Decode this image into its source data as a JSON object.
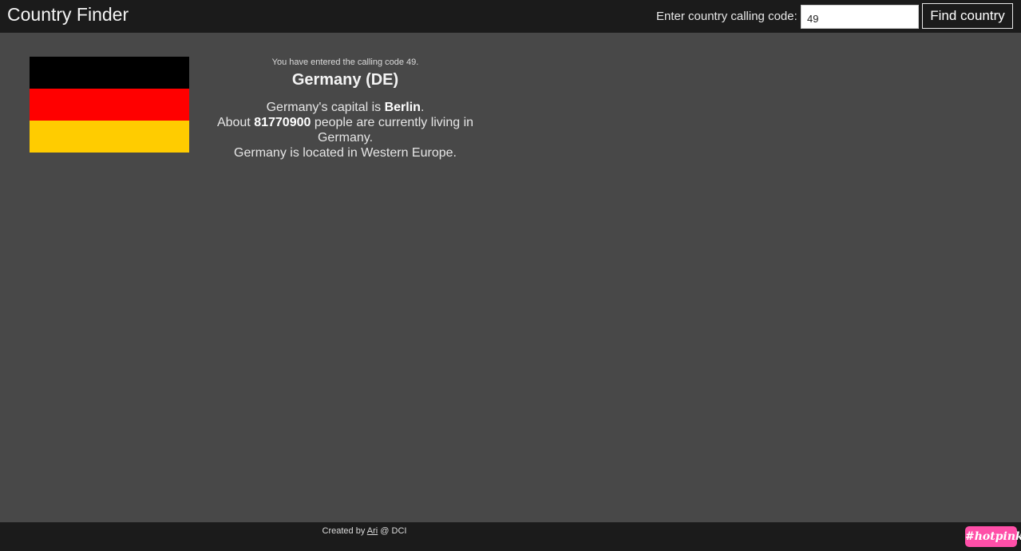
{
  "header": {
    "app_title": "Country Finder",
    "search_label": "Enter country calling code:",
    "search_value": "49",
    "find_button_label": "Find country"
  },
  "flag": {
    "stripes": [
      "#000000",
      "#ff0000",
      "#ffcc00"
    ]
  },
  "result": {
    "entered_note": "You have entered the calling code 49.",
    "country_title": "Germany (DE)",
    "capital_prefix": "Germany's capital is ",
    "capital": "Berlin",
    "capital_suffix": ".",
    "population_prefix": "About ",
    "population": "81770900",
    "population_suffix": " people are currently living in Germany.",
    "region_sentence": "Germany is located in Western Europe."
  },
  "footer": {
    "prefix": "Created by ",
    "author_link": "Ari",
    "suffix": " @ DCI",
    "badge": "#hotpink"
  }
}
